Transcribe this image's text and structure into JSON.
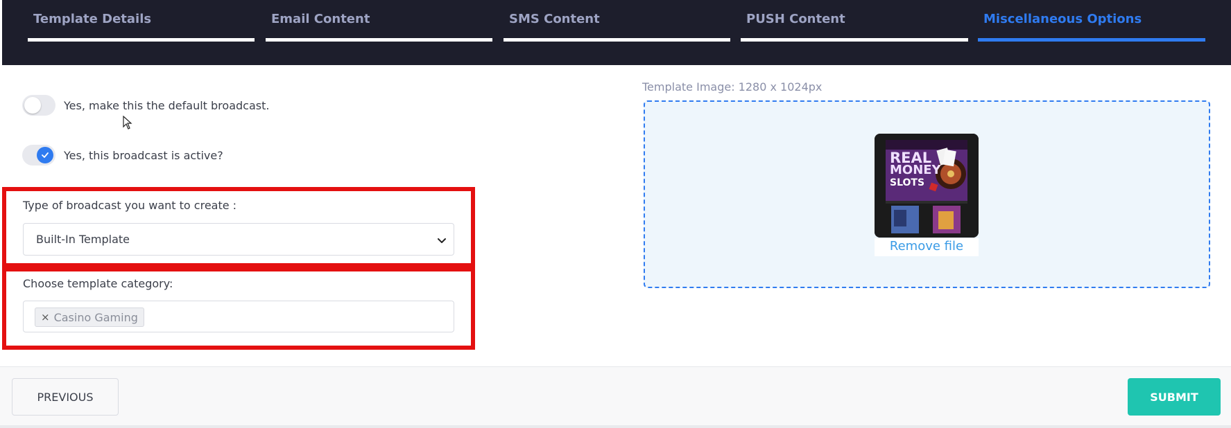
{
  "tabs": [
    {
      "label": "Template Details",
      "active": false
    },
    {
      "label": "Email Content",
      "active": false
    },
    {
      "label": "SMS Content",
      "active": false
    },
    {
      "label": "PUSH Content",
      "active": false
    },
    {
      "label": "Miscellaneous Options",
      "active": true
    }
  ],
  "toggles": {
    "default_broadcast": {
      "label": "Yes, make this the default broadcast.",
      "checked": false
    },
    "active_broadcast": {
      "label": "Yes, this broadcast is active?",
      "checked": true
    }
  },
  "broadcast_type": {
    "label": "Type of broadcast you want to create :",
    "selected": "Built-In Template"
  },
  "template_category": {
    "label": "Choose template category:",
    "tags": [
      "Casino Gaming"
    ],
    "remove_glyph": "×"
  },
  "template_image": {
    "label": "Template Image: 1280 x 1024px",
    "thumbnail_text_line1": "REAL",
    "thumbnail_text_line2": "MONEY",
    "thumbnail_text_line3": "SLOTS",
    "remove_label": "Remove file"
  },
  "footer": {
    "previous_label": "PREVIOUS",
    "submit_label": "SUBMIT"
  },
  "colors": {
    "accent": "#2f7bf0",
    "topbar": "#1d1e2c",
    "highlight": "#e41010",
    "submit": "#1fc5b0",
    "link": "#3a9be6"
  }
}
